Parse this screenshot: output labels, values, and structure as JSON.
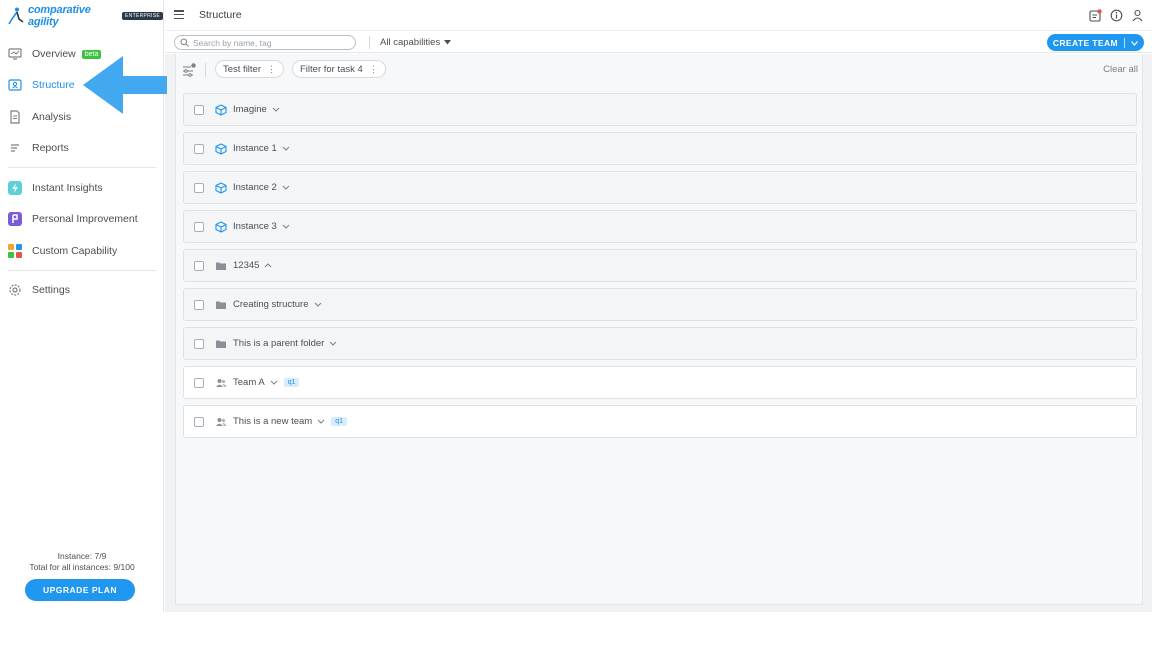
{
  "app": {
    "logo_text": "comparative agility",
    "logo_badge": "ENTERPRISE"
  },
  "sidebar": {
    "items": [
      {
        "label": "Overview",
        "icon": "monitor-icon",
        "badge": "beta"
      },
      {
        "label": "Structure",
        "icon": "structure-icon",
        "active": true
      },
      {
        "label": "Analysis",
        "icon": "document-icon"
      },
      {
        "label": "Reports",
        "icon": "list-icon"
      },
      {
        "label": "Instant Insights",
        "icon": "lightning-icon"
      },
      {
        "label": "Personal Improvement",
        "icon": "person-improve-icon"
      },
      {
        "label": "Custom Capability",
        "icon": "grid-icon"
      },
      {
        "label": "Settings",
        "icon": "gear-icon"
      }
    ],
    "instance_count": "Instance: 7/9",
    "total_instances": "Total for all instances: 9/100",
    "upgrade_label": "UPGRADE PLAN"
  },
  "header": {
    "title": "Structure",
    "icons": [
      "notification-icon",
      "info-icon",
      "user-icon"
    ]
  },
  "toolbar": {
    "search_placeholder": "Search by name, tag",
    "capabilities_select": "All capabilities",
    "create_team_label": "CREATE TEAM"
  },
  "filters": {
    "chips": [
      "Test filter",
      "Filter for task 4"
    ],
    "clear_all": "Clear all"
  },
  "rows": [
    {
      "label": "Imagine",
      "icon": "cube-icon",
      "expanded": false
    },
    {
      "label": "Instance 1",
      "icon": "cube-icon",
      "expanded": false
    },
    {
      "label": "Instance 2",
      "icon": "cube-icon",
      "expanded": false
    },
    {
      "label": "Instance 3",
      "icon": "cube-icon",
      "expanded": false
    },
    {
      "label": "12345",
      "icon": "folder-icon",
      "expanded": true
    },
    {
      "label": "Creating structure",
      "icon": "folder-icon",
      "expanded": false
    },
    {
      "label": "This is a parent folder",
      "icon": "folder-icon",
      "expanded": false
    },
    {
      "label": "Team A",
      "icon": "team-icon",
      "expanded": false,
      "tag": "q1"
    },
    {
      "label": "This is a new team",
      "icon": "team-icon",
      "expanded": false,
      "tag": "q1"
    }
  ],
  "colors": {
    "accent": "#1f97ee",
    "beta": "#3cc43c",
    "arrow": "#42a8f0"
  }
}
